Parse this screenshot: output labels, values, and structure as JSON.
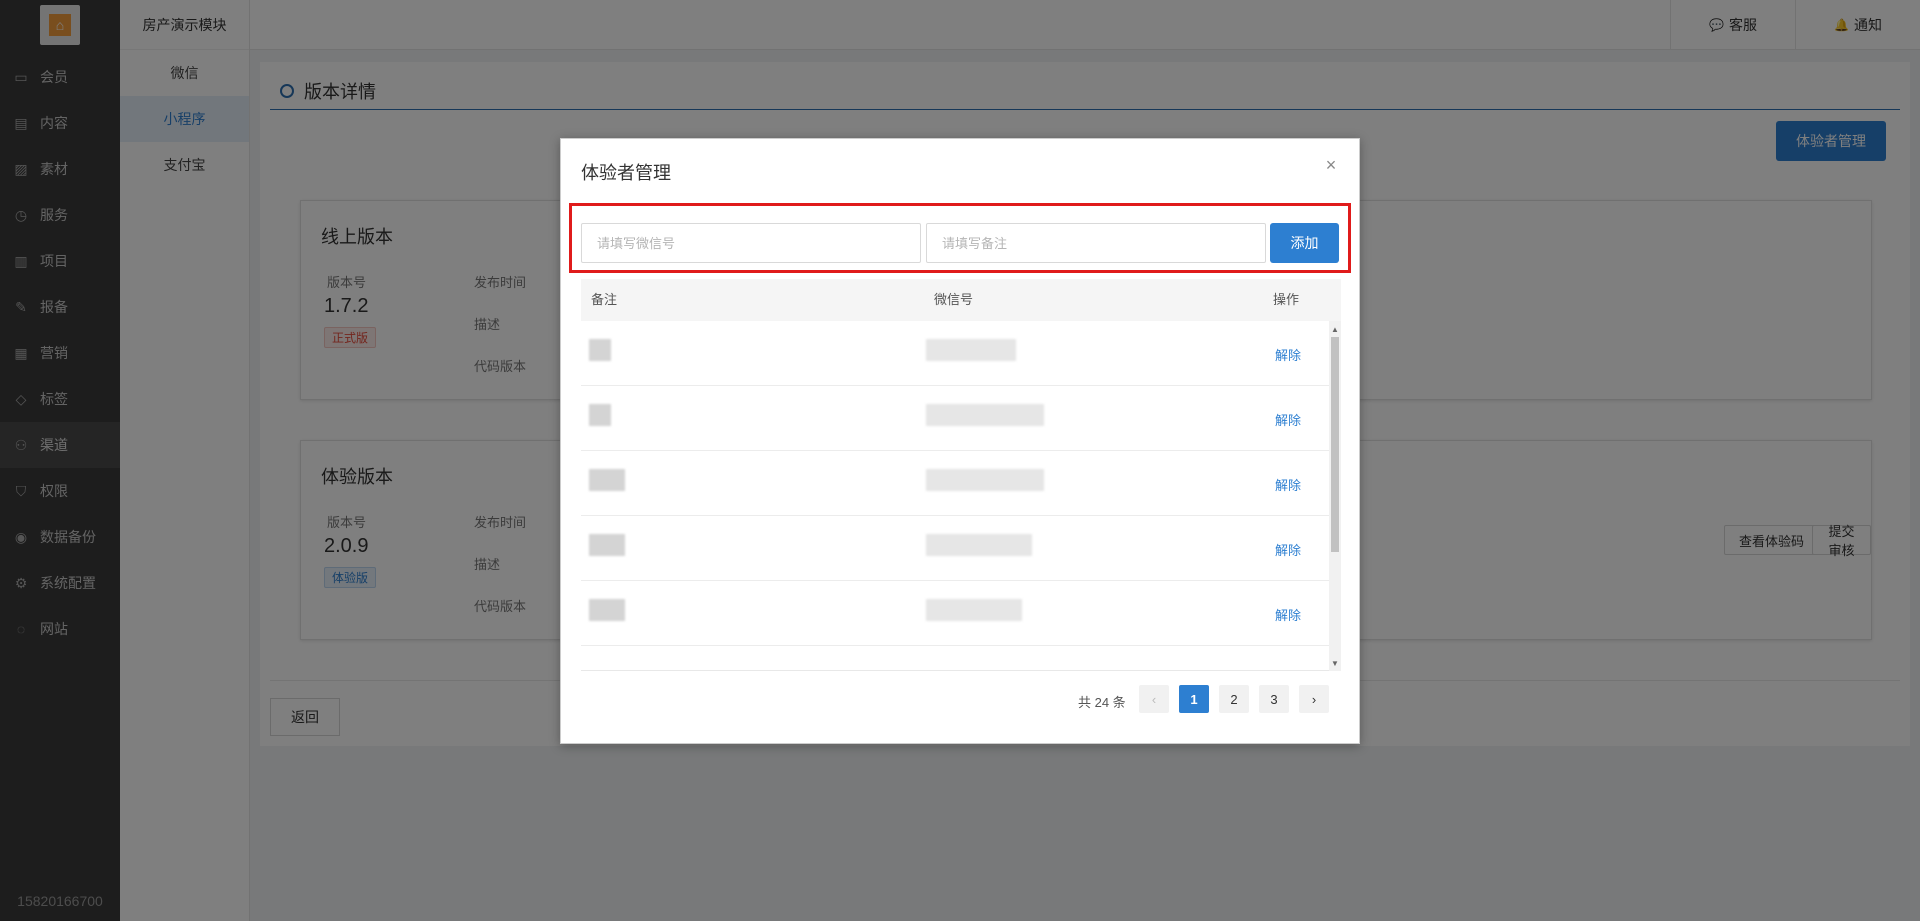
{
  "app": {
    "module_title": "房产演示模块",
    "user_phone": "15820166700",
    "colors": {
      "primary": "#2d7fd1",
      "sidebar": "#3a3a3a",
      "highlight": "#e01b1b"
    }
  },
  "sidebar": {
    "items": [
      {
        "label": "会员",
        "icon": "member-card-icon"
      },
      {
        "label": "内容",
        "icon": "document-icon"
      },
      {
        "label": "素材",
        "icon": "image-icon"
      },
      {
        "label": "服务",
        "icon": "clock-icon"
      },
      {
        "label": "项目",
        "icon": "building-icon"
      },
      {
        "label": "报备",
        "icon": "report-icon"
      },
      {
        "label": "营销",
        "icon": "chart-icon"
      },
      {
        "label": "标签",
        "icon": "tag-icon"
      },
      {
        "label": "渠道",
        "icon": "channel-icon"
      },
      {
        "label": "权限",
        "icon": "shield-icon"
      },
      {
        "label": "数据备份",
        "icon": "backup-icon"
      },
      {
        "label": "系统配置",
        "icon": "gear-icon"
      },
      {
        "label": "网站",
        "icon": "globe-icon"
      }
    ],
    "active_index": 8
  },
  "subnav": {
    "items": [
      "微信",
      "小程序",
      "支付宝"
    ],
    "active_index": 1
  },
  "topbar": {
    "service_label": "客服",
    "notify_label": "通知"
  },
  "page": {
    "title": "版本详情",
    "manage_button": "体验者管理",
    "back_button": "返回",
    "online": {
      "title": "线上版本",
      "version_label": "版本号",
      "version": "1.7.2",
      "tag": "正式版",
      "publish_label": "发布时间",
      "desc_label": "描述",
      "code_label": "代码版本"
    },
    "trial": {
      "title": "体验版本",
      "version_label": "版本号",
      "version": "2.0.9",
      "tag": "体验版",
      "publish_label": "发布时间",
      "desc_label": "描述",
      "code_label": "代码版本",
      "qr_button": "查看体验码",
      "submit_button": "提交审核"
    }
  },
  "modal": {
    "title": "体验者管理",
    "wechat_placeholder": "请填写微信号",
    "remark_placeholder": "请填写备注",
    "add_button": "添加",
    "columns": {
      "remark": "备注",
      "wechat": "微信号",
      "action": "操作"
    },
    "action_label": "解除",
    "rows": 5,
    "total_text": "共 24 条",
    "pages": [
      "1",
      "2",
      "3"
    ],
    "current_page": 1
  }
}
